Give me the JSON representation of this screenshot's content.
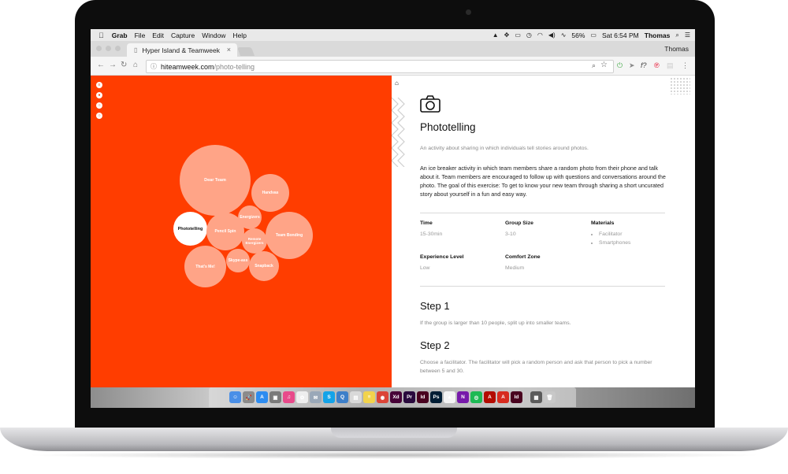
{
  "menubar": {
    "apple": "",
    "app_name": "Grab",
    "items": [
      "File",
      "Edit",
      "Capture",
      "Window",
      "Help"
    ],
    "battery": "56%",
    "clock": "Sat 6:54 PM",
    "user": "Thomas"
  },
  "browser": {
    "tab_title": "Hyper Island & Teamweek",
    "profile": "Thomas",
    "url_host": "hiteamweek.com",
    "url_path": "/photo-telling"
  },
  "bubbles": [
    {
      "label": "Dear Team"
    },
    {
      "label": "Handvas"
    },
    {
      "label": "Energizers"
    },
    {
      "label": "Phototelling"
    },
    {
      "label": "Pencil Spin"
    },
    {
      "label": "Remote Energizers"
    },
    {
      "label": "Team Bonding"
    },
    {
      "label": "Skype-ass"
    },
    {
      "label": "That's Me!"
    },
    {
      "label": "Snapback"
    }
  ],
  "activity": {
    "title": "Phototelling",
    "summary": "An activity about sharing in which individuals tell stories around photos.",
    "description": "An ice breaker activity in which team members share a random photo from their phone and talk about it. Team members are encouraged to follow up with questions and conversations around the photo. The goal of this exercise: To get to know your new team through sharing a short uncurated story about yourself in a fun and easy way.",
    "time_label": "Time",
    "time_value": "15-30min",
    "group_label": "Group Size",
    "group_value": "3-10",
    "materials_label": "Materials",
    "materials": [
      "Facilitator",
      "Smartphones"
    ],
    "experience_label": "Experience Level",
    "experience_value": "Low",
    "comfort_label": "Comfort Zone",
    "comfort_value": "Medium",
    "steps": [
      {
        "title": "Step 1",
        "text": "If the group is larger than 10 people, split up into smaller teams."
      },
      {
        "title": "Step 2",
        "text": "Choose a facilitator. The facilitator will pick a random person and ask that person to pick a number between 5 and 30."
      }
    ]
  },
  "colors": {
    "accent": "#ff3d00",
    "bubble": "#ffa487"
  },
  "dock": [
    {
      "name": "finder-icon",
      "color": "#4a8fe7",
      "glyph": "☺"
    },
    {
      "name": "launchpad-icon",
      "color": "#8b8b8b",
      "glyph": "🚀"
    },
    {
      "name": "app-store-icon",
      "color": "#2d8cf0",
      "glyph": "A"
    },
    {
      "name": "preview-icon",
      "color": "#7a7a7a",
      "glyph": "▣"
    },
    {
      "name": "itunes-icon",
      "color": "#e84a8a",
      "glyph": "♫"
    },
    {
      "name": "photos-icon",
      "color": "#eeeeee",
      "glyph": "✿"
    },
    {
      "name": "mail-icon",
      "color": "#9aa8b8",
      "glyph": "✉"
    },
    {
      "name": "skype-icon",
      "color": "#14a3e8",
      "glyph": "S"
    },
    {
      "name": "quicktime-icon",
      "color": "#3d7fc9",
      "glyph": "Q"
    },
    {
      "name": "documents-icon",
      "color": "#d9d9d9",
      "glyph": "▤"
    },
    {
      "name": "notes-icon",
      "color": "#f2d34c",
      "glyph": "≡"
    },
    {
      "name": "chrome-icon",
      "color": "#db4437",
      "glyph": "◉"
    },
    {
      "name": "xd-icon",
      "color": "#470137",
      "glyph": "Xd"
    },
    {
      "name": "premiere-icon",
      "color": "#2a0a3d",
      "glyph": "Pr"
    },
    {
      "name": "indesign-icon",
      "color": "#49021f",
      "glyph": "Id"
    },
    {
      "name": "photoshop-icon",
      "color": "#001d34",
      "glyph": "Ps"
    },
    {
      "name": "drive-icon",
      "color": "#f4f4f4",
      "glyph": "▲"
    },
    {
      "name": "onenote-icon",
      "color": "#7719aa",
      "glyph": "N"
    },
    {
      "name": "spotify-icon",
      "color": "#1db954",
      "glyph": "◎"
    },
    {
      "name": "acrobat-icon",
      "color": "#b30b00",
      "glyph": "A"
    },
    {
      "name": "acrobat-reader-icon",
      "color": "#d72b1f",
      "glyph": "A"
    },
    {
      "name": "indesign-alt-icon",
      "color": "#49021f",
      "glyph": "Id"
    },
    {
      "name": "folder-icon",
      "color": "#5b5b5b",
      "glyph": "▦"
    },
    {
      "name": "trash-icon",
      "color": "#c8c8c8",
      "glyph": "🗑"
    }
  ]
}
